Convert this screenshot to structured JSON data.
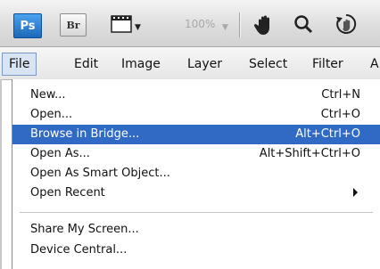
{
  "toolbar": {
    "ps_logo": "Ps",
    "br_logo": "Br",
    "zoom_value": "100%",
    "icons": [
      "screen-mode-icon",
      "hand-tool-icon",
      "zoom-tool-icon",
      "rotate-view-icon"
    ]
  },
  "menubar": {
    "items": [
      {
        "label": "File",
        "active": true
      },
      {
        "label": "Edit"
      },
      {
        "label": "Image"
      },
      {
        "label": "Layer"
      },
      {
        "label": "Select"
      },
      {
        "label": "Filter"
      },
      {
        "label": "A"
      }
    ]
  },
  "file_menu": {
    "items": [
      {
        "label": "New...",
        "shortcut": "Ctrl+N"
      },
      {
        "label": "Open...",
        "shortcut": "Ctrl+O"
      },
      {
        "label": "Browse in Bridge...",
        "shortcut": "Alt+Ctrl+O",
        "highlighted": true
      },
      {
        "label": "Open As...",
        "shortcut": "Alt+Shift+Ctrl+O"
      },
      {
        "label": "Open As Smart Object..."
      },
      {
        "label": "Open Recent",
        "submenu": true
      },
      {
        "label": "Share My Screen..."
      },
      {
        "label": "Device Central..."
      }
    ]
  },
  "colors": {
    "highlight": "#316ac5",
    "ps_blue": "#1c67b8",
    "active_menu_bg": "#d8e4f3"
  }
}
